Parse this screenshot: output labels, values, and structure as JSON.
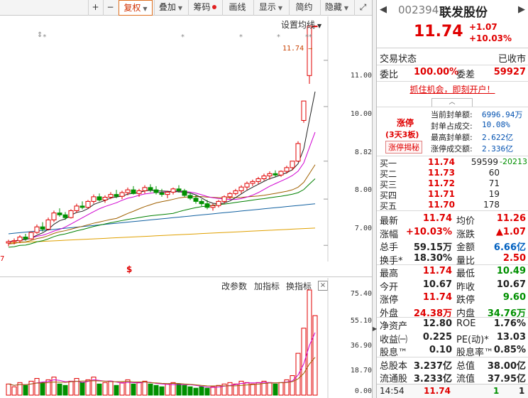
{
  "toolbar": {
    "plus": "+",
    "minus": "−",
    "fuquan": "复权",
    "diejia": "叠加",
    "chouma": "筹码",
    "huaxian": "画线",
    "xianshi": "显示",
    "jianyue": "简约",
    "yincang": "隐藏",
    "expand": "⤢"
  },
  "main_pane": {
    "settings_label": "设置均线",
    "last_price_tag": "11.74",
    "y_ticks": [
      "11.00",
      "10.00",
      "8.82",
      "8.00",
      "7.00"
    ],
    "left_edge_label": "7",
    "event_markers": [
      "⇕⁎",
      "⁎",
      "⁎",
      "⁎",
      "⁎⁎"
    ],
    "center_marker": "$"
  },
  "vol_pane": {
    "param_btn": "改参数",
    "add_btn": "加指标",
    "switch_btn": "换指标",
    "close": "×",
    "y_ticks": [
      "75.40",
      "55.10",
      "36.90",
      "18.70",
      "0.00"
    ]
  },
  "stock": {
    "code": "002394",
    "name": "联发股份",
    "price": "11.74",
    "change": "+1.07",
    "change_pct": "+10.03%",
    "nav_prev": "◀",
    "nav_next": "▶"
  },
  "status": {
    "label": "交易状态",
    "value": "已收市"
  },
  "weibi": {
    "label1": "委比",
    "value1": "100.00%",
    "label2": "委差",
    "value2": "59927"
  },
  "promo": "抓住机会，即刻开户！",
  "limit_up": {
    "title": "涨停",
    "streak": "(3天3板)",
    "reveal": "涨停揭秘",
    "items": [
      {
        "k": "当前封单额:",
        "v": "6996.94万"
      },
      {
        "k": "封单占成交:",
        "v": "10.08%"
      },
      {
        "k": "最高封单额:",
        "v": "2.622亿"
      },
      {
        "k": "涨停成交额:",
        "v": "2.336亿"
      }
    ]
  },
  "bids": [
    {
      "label": "买一",
      "price": "11.74",
      "vol": "59599",
      "extra": "-20213"
    },
    {
      "label": "买二",
      "price": "11.73",
      "vol": "60",
      "extra": ""
    },
    {
      "label": "买三",
      "price": "11.72",
      "vol": "71",
      "extra": ""
    },
    {
      "label": "买四",
      "price": "11.71",
      "vol": "19",
      "extra": ""
    },
    {
      "label": "买五",
      "price": "11.70",
      "vol": "178",
      "extra": ""
    }
  ],
  "quote_rows": [
    {
      "k1": "最新",
      "v1": "11.74",
      "c1": "red",
      "k2": "均价",
      "v2": "11.26",
      "c2": "red"
    },
    {
      "k1": "涨幅",
      "v1": "+10.03%",
      "c1": "red",
      "k2": "涨跌",
      "v2": "▲1.07",
      "c2": "red"
    },
    {
      "k1": "总手",
      "v1": "59.15万",
      "c1": "dk",
      "k2": "金额",
      "v2": "6.66亿",
      "c2": "blue"
    },
    {
      "k1": "换手*",
      "v1": "18.30%",
      "c1": "dk",
      "k2": "量比",
      "v2": "2.50",
      "c2": "red"
    },
    {
      "k1": "最高",
      "v1": "11.74",
      "c1": "red",
      "k2": "最低",
      "v2": "10.49",
      "c2": "green"
    },
    {
      "k1": "今开",
      "v1": "10.67",
      "c1": "dk",
      "k2": "昨收",
      "v2": "10.67",
      "c2": "dk"
    },
    {
      "k1": "涨停",
      "v1": "11.74",
      "c1": "red",
      "k2": "跌停",
      "v2": "9.60",
      "c2": "green"
    },
    {
      "k1": "外盘",
      "v1": "24.38万",
      "c1": "red",
      "k2": "内盘",
      "v2": "34.76万",
      "c2": "green"
    },
    {
      "k1": "净资产",
      "v1": "12.80",
      "c1": "dk",
      "k2": "ROE",
      "v2": "1.76%",
      "c2": "dk"
    },
    {
      "k1": "收益㈠",
      "v1": "0.225",
      "c1": "dk",
      "k2": "PE(动)*",
      "v2": "13.03",
      "c2": "dk"
    },
    {
      "k1": "股息™",
      "v1": "0.10",
      "c1": "dk",
      "k2": "股息率™",
      "v2": "0.85%",
      "c2": "dk"
    },
    {
      "k1": "总股本",
      "v1": "3.237亿",
      "c1": "dk",
      "k2": "总值",
      "v2": "38.00亿",
      "c2": "dk"
    },
    {
      "k1": "流通股",
      "v1": "3.233亿",
      "c1": "dk",
      "k2": "流值",
      "v2": "37.95亿",
      "c2": "dk"
    }
  ],
  "tick": {
    "time": "14:54",
    "price": "11.74",
    "vol": "1",
    "count": "1"
  },
  "colors": {
    "up": "#e00000",
    "down": "#009000",
    "ma5": "#202020",
    "ma10": "#d000d0",
    "ma20": "#a06000",
    "ma30": "#008000",
    "ma60": "#1060a0",
    "ma120": "#e0a000"
  },
  "chart_data": {
    "type": "candlestick",
    "ylim": [
      6.65,
      11.95
    ],
    "candles": [
      [
        7.05,
        7.12,
        6.98,
        7.08
      ],
      [
        7.08,
        7.15,
        7.02,
        7.1
      ],
      [
        7.1,
        7.22,
        7.05,
        7.18
      ],
      [
        7.18,
        7.25,
        7.1,
        7.14
      ],
      [
        7.14,
        7.3,
        7.12,
        7.28
      ],
      [
        7.28,
        7.45,
        7.25,
        7.4
      ],
      [
        7.4,
        7.5,
        7.3,
        7.35
      ],
      [
        7.35,
        7.6,
        7.32,
        7.55
      ],
      [
        7.55,
        7.75,
        7.5,
        7.7
      ],
      [
        7.7,
        7.8,
        7.62,
        7.66
      ],
      [
        7.66,
        7.72,
        7.55,
        7.6
      ],
      [
        7.6,
        7.78,
        7.58,
        7.75
      ],
      [
        7.75,
        7.9,
        7.7,
        7.85
      ],
      [
        7.85,
        7.95,
        7.78,
        7.82
      ],
      [
        7.82,
        7.98,
        7.8,
        7.95
      ],
      [
        7.95,
        8.1,
        7.9,
        8.05
      ],
      [
        8.05,
        8.12,
        7.95,
        7.98
      ],
      [
        7.98,
        8.08,
        7.92,
        8.04
      ],
      [
        8.04,
        8.15,
        8.0,
        8.1
      ],
      [
        8.1,
        8.2,
        8.02,
        8.06
      ],
      [
        8.06,
        8.18,
        8.0,
        8.14
      ],
      [
        8.14,
        8.25,
        8.08,
        8.2
      ],
      [
        8.2,
        8.28,
        8.1,
        8.12
      ],
      [
        8.12,
        8.22,
        8.05,
        8.18
      ],
      [
        8.18,
        8.3,
        8.12,
        8.25
      ],
      [
        8.25,
        8.32,
        8.15,
        8.2
      ],
      [
        8.2,
        8.28,
        8.1,
        8.14
      ],
      [
        8.14,
        8.22,
        8.05,
        8.1
      ],
      [
        8.1,
        8.18,
        8.02,
        8.15
      ],
      [
        8.15,
        8.25,
        8.1,
        8.22
      ],
      [
        8.22,
        8.3,
        8.14,
        8.18
      ],
      [
        8.18,
        8.22,
        8.05,
        8.08
      ],
      [
        8.08,
        8.14,
        7.98,
        8.02
      ],
      [
        8.02,
        8.08,
        7.9,
        7.95
      ],
      [
        7.95,
        8.0,
        7.85,
        7.9
      ],
      [
        7.9,
        7.98,
        7.78,
        7.82
      ],
      [
        7.82,
        7.9,
        7.75,
        7.86
      ],
      [
        7.86,
        7.98,
        7.82,
        7.95
      ],
      [
        7.95,
        8.08,
        7.9,
        8.05
      ],
      [
        8.05,
        8.15,
        8.0,
        8.12
      ],
      [
        8.12,
        8.22,
        8.08,
        8.18
      ],
      [
        8.18,
        8.3,
        8.12,
        8.26
      ],
      [
        8.26,
        8.38,
        8.2,
        8.34
      ],
      [
        8.34,
        8.42,
        8.28,
        8.38
      ],
      [
        8.38,
        8.48,
        8.32,
        8.44
      ],
      [
        8.44,
        8.55,
        8.4,
        8.5
      ],
      [
        8.5,
        8.6,
        8.42,
        8.55
      ],
      [
        8.55,
        8.62,
        8.48,
        8.52
      ],
      [
        8.52,
        8.62,
        8.48,
        8.6
      ],
      [
        8.6,
        8.72,
        8.55,
        8.68
      ],
      [
        8.68,
        8.8,
        8.62,
        8.82
      ],
      [
        8.82,
        9.25,
        8.8,
        9.2
      ],
      [
        9.7,
        10.12,
        9.65,
        10.12
      ],
      [
        10.67,
        11.2,
        10.49,
        11.74
      ],
      [
        11.74,
        11.74,
        11.74,
        11.74
      ]
    ],
    "volumes": [
      8,
      6,
      9,
      7,
      10,
      12,
      9,
      11,
      13,
      8,
      7,
      10,
      12,
      9,
      11,
      13,
      8,
      9,
      10,
      7,
      9,
      11,
      8,
      9,
      10,
      8,
      7,
      6,
      8,
      9,
      8,
      7,
      6,
      5,
      6,
      5,
      6,
      7,
      8,
      9,
      8,
      10,
      9,
      8,
      9,
      10,
      9,
      8,
      9,
      11,
      14,
      30,
      48,
      75.4,
      57
    ]
  }
}
